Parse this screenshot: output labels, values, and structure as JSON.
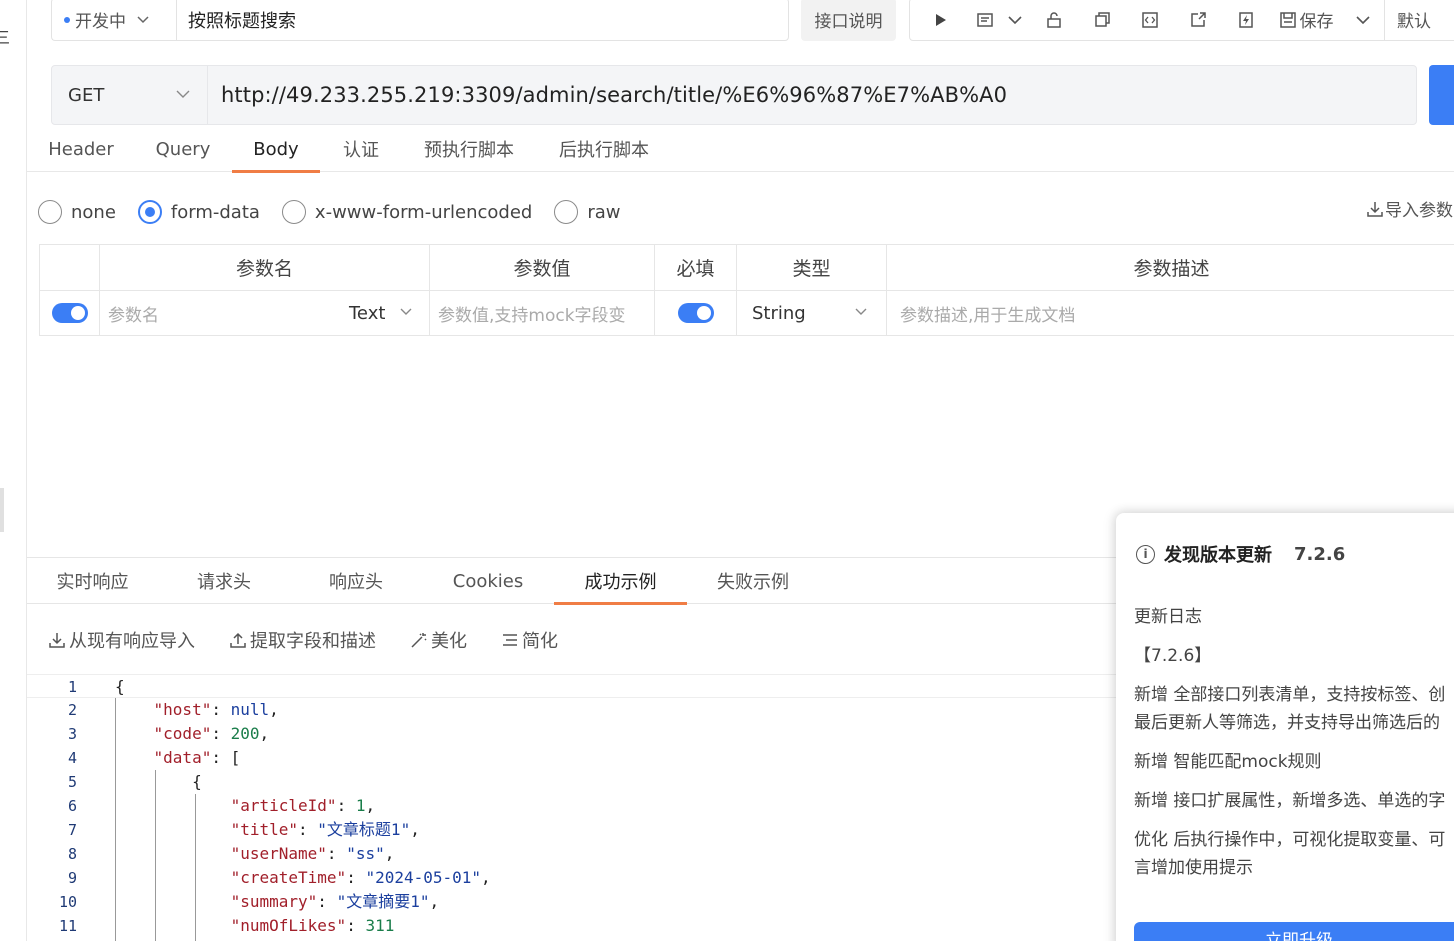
{
  "left_strip": {
    "glyph": "三"
  },
  "topbar": {
    "status_label": "开发中",
    "title_value": "按照标题搜索",
    "doc_button": "接口说明",
    "save_label": "保存",
    "default_label": "默认"
  },
  "request": {
    "method": "GET",
    "url": "http://49.233.255.219:3309/admin/search/title/%E6%96%87%E7%AB%A0"
  },
  "req_tabs": [
    "Header",
    "Query",
    "Body",
    "认证",
    "预执行脚本",
    "后执行脚本"
  ],
  "req_tab_active": "Body",
  "body_types": {
    "none": "none",
    "form_data": "form-data",
    "urlencoded": "x-www-form-urlencoded",
    "raw": "raw",
    "selected": "form-data"
  },
  "import_params": "导入参数",
  "params_table": {
    "headers": {
      "name": "参数名",
      "value": "参数值",
      "required": "必填",
      "type": "类型",
      "desc": "参数描述"
    },
    "row": {
      "name_placeholder": "参数名",
      "name_type": "Text",
      "value_placeholder": "参数值,支持mock字段变",
      "type": "String",
      "desc_placeholder": "参数描述,用于生成文档"
    }
  },
  "resp_tabs": [
    "实时响应",
    "请求头",
    "响应头",
    "Cookies",
    "成功示例",
    "失败示例"
  ],
  "resp_tab_active": "成功示例",
  "resp_tools": {
    "import": "从现有响应导入",
    "extract": "提取字段和描述",
    "beautify": "美化",
    "simplify": "简化"
  },
  "code": {
    "line_numbers": [
      "1",
      "2",
      "3",
      "4",
      "5",
      "6",
      "7",
      "8",
      "9",
      "10",
      "11"
    ],
    "host_key": "\"host\"",
    "host_val": "null",
    "code_key": "\"code\"",
    "code_val": "200",
    "data_key": "\"data\"",
    "articleId_key": "\"articleId\"",
    "articleId_val": "1",
    "title_key": "\"title\"",
    "title_val": "\"文章标题1\"",
    "userName_key": "\"userName\"",
    "userName_val": "\"ss\"",
    "createTime_key": "\"createTime\"",
    "createTime_val": "\"2024-05-01\"",
    "summary_key": "\"summary\"",
    "summary_val": "\"文章摘要1\"",
    "numOfLikes_key": "\"numOfLikes\"",
    "numOfLikes_val": "311"
  },
  "update_panel": {
    "title": "发现版本更新",
    "version": "7.2.6",
    "log_title": "更新日志",
    "version_tag": "【7.2.6】",
    "item1_line1": "新增 全部接口列表清单，支持按标签、创",
    "item1_line2": "最后更新人等筛选，并支持导出筛选后的",
    "item2": "新增 智能匹配mock规则",
    "item3": "新增 接口扩展属性，新增多选、单选的字",
    "item4_line1": "优化 后执行操作中，可视化提取变量、可",
    "item4_line2": "言增加使用提示",
    "button": "立即升级"
  },
  "colors": {
    "accent": "#3b7ef5",
    "tab_underline": "#f07d45"
  }
}
